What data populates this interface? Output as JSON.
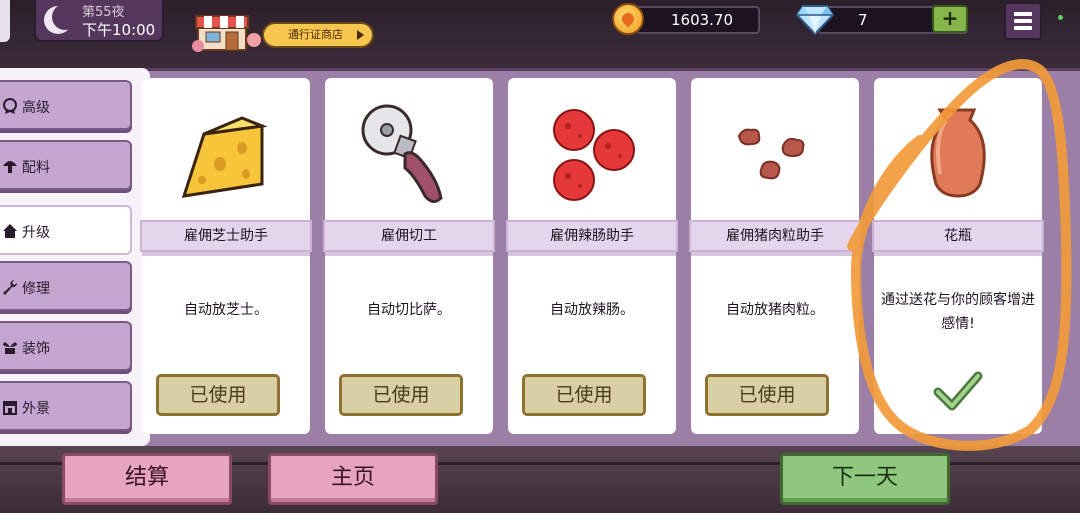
{
  "topbar": {
    "night_day": "第55夜",
    "night_time": "下午10:00",
    "shop_label": "通行证商店",
    "coins": "1603.70",
    "gems": "7",
    "gems_add": "+"
  },
  "sidebar": {
    "tabs": [
      {
        "label": "高级",
        "icon": "badge-icon"
      },
      {
        "label": "配料",
        "icon": "mushroom-icon"
      },
      {
        "label": "升级",
        "icon": "house-icon"
      },
      {
        "label": "修理",
        "icon": "wrench-icon"
      },
      {
        "label": "装饰",
        "icon": "plant-icon"
      },
      {
        "label": "外景",
        "icon": "storefront-icon"
      }
    ],
    "active_tab": "升级"
  },
  "cards": [
    {
      "name": "雇佣芝士助手",
      "desc": "自动放芝士。",
      "button": "已使用",
      "icon": "cheese-icon"
    },
    {
      "name": "雇佣切工",
      "desc": "自动切比萨。",
      "button": "已使用",
      "icon": "pizza-cutter-icon"
    },
    {
      "name": "雇佣辣肠助手",
      "desc": "自动放辣肠。",
      "button": "已使用",
      "icon": "pepperoni-icon"
    },
    {
      "name": "雇佣猪肉粒助手",
      "desc": "自动放猪肉粒。",
      "button": "已使用",
      "icon": "pork-crumbles-icon"
    },
    {
      "name": "花瓶",
      "desc": "通过送花与你的顾客增进感情!",
      "icon": "vase-icon",
      "status": "checkmark-icon"
    }
  ],
  "bottom": {
    "settle": "结算",
    "home": "主页",
    "next_day": "下一天"
  },
  "colors": {
    "panel": "#9b7fa6",
    "tab": "#c4a6d0",
    "used_button": "#d9cfa4",
    "next_button": "#8fc77e",
    "pink_button": "#e6a4c0",
    "annotation": "#f29a3a"
  }
}
